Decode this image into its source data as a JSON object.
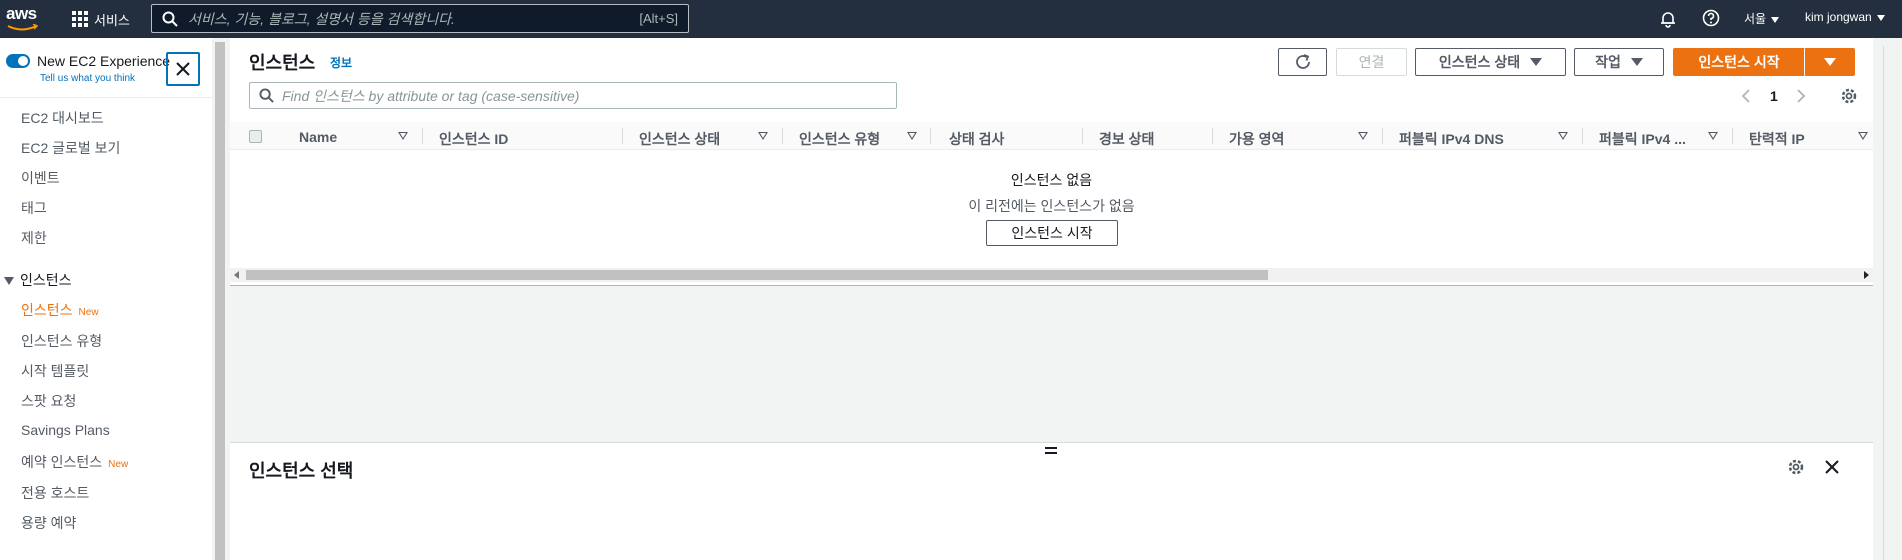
{
  "topbar": {
    "logo_text": "aws",
    "services_label": "서비스",
    "search_placeholder": "서비스, 기능, 블로그, 설명서 등을 검색합니다.",
    "search_shortcut": "[Alt+S]",
    "region": "서울",
    "user": "kim jongwan"
  },
  "sidebar": {
    "new_experience_label": "New EC2 Experience",
    "tell_us_link": "Tell us what you think",
    "items_top": [
      "EC2 대시보드",
      "EC2 글로벌 보기",
      "이벤트",
      "태그",
      "제한"
    ],
    "section_instances": "인스턴스",
    "items_instances": [
      {
        "label": "인스턴스",
        "badge": "New"
      },
      {
        "label": "인스턴스 유형",
        "badge": ""
      },
      {
        "label": "시작 템플릿",
        "badge": ""
      },
      {
        "label": "스팟 요청",
        "badge": ""
      },
      {
        "label": "Savings Plans",
        "badge": ""
      },
      {
        "label": "예약 인스턴스",
        "badge": "New"
      },
      {
        "label": "전용 호스트",
        "badge": ""
      },
      {
        "label": "용량 예약",
        "badge": ""
      }
    ]
  },
  "main": {
    "title": "인스턴스",
    "info_link": "정보",
    "buttons": {
      "connect": "연결",
      "instance_state": "인스턴스 상태",
      "actions": "작업",
      "launch": "인스턴스 시작"
    },
    "filter_placeholder": "Find 인스턴스 by attribute or tag (case-sensitive)",
    "page_number": "1",
    "columns": [
      "Name",
      "인스턴스 ID",
      "인스턴스 상태",
      "인스턴스 유형",
      "상태 검사",
      "경보 상태",
      "가용 영역",
      "퍼블릭 IPv4 DNS",
      "퍼블릭 IPv4 ...",
      "탄력적 IP"
    ],
    "empty": {
      "title": "인스턴스 없음",
      "subtitle": "이 리전에는 인스턴스가 없음",
      "button": "인스턴스 시작"
    },
    "detail_title": "인스턴스 선택"
  },
  "colors": {
    "accent_orange": "#ec7211",
    "link_blue": "#0073bb",
    "topbar_bg": "#232f3e"
  }
}
